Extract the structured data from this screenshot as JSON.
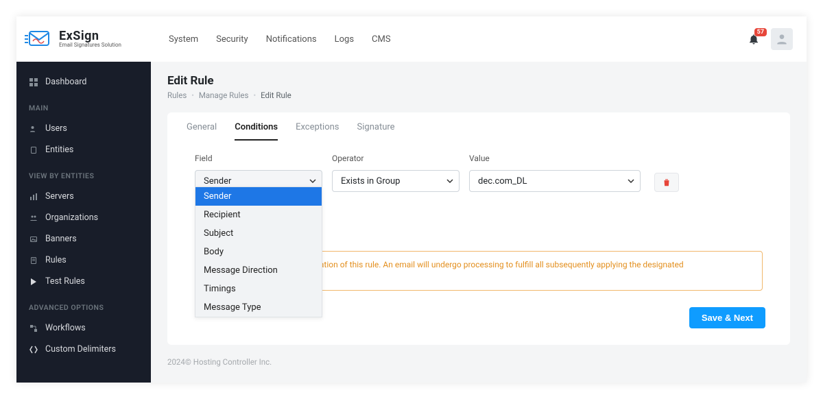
{
  "brand": {
    "name": "ExSign",
    "tagline": "Email Signatures Solution"
  },
  "topnav": {
    "items": [
      "System",
      "Security",
      "Notifications",
      "Logs",
      "CMS"
    ]
  },
  "notifications": {
    "count": "57"
  },
  "sidebar": {
    "dashboard": "Dashboard",
    "heading_main": "MAIN",
    "main_items": [
      "Users",
      "Entities"
    ],
    "heading_view": "VIEW BY ENTITIES",
    "view_items": [
      "Servers",
      "Organizations",
      "Banners",
      "Rules",
      "Test Rules"
    ],
    "heading_adv": "ADVANCED OPTIONS",
    "adv_items": [
      "Workflows",
      "Custom Delimiters"
    ]
  },
  "page": {
    "title": "Edit Rule",
    "crumbs": {
      "a": "Rules",
      "b": "Manage Rules",
      "c": "Edit Rule"
    }
  },
  "tabs": {
    "general": "General",
    "conditions": "Conditions",
    "exceptions": "Exceptions",
    "signature": "Signature"
  },
  "columns": {
    "field": "Field",
    "operator": "Operator",
    "value": "Value"
  },
  "row": {
    "field": "Sender",
    "operator": "Exists in Group",
    "value": "dec.com_DL"
  },
  "field_options": [
    "Sender",
    "Recipient",
    "Subject",
    "Body",
    "Message Direction",
    "Timings",
    "Message Type"
  ],
  "note": "must be satisfied for the application of this rule. An email will undergo processing to fulfill all subsequently applying the designated Signature/Disclaimer.",
  "save_next": "Save & Next",
  "footer": "2024© Hosting Controller Inc."
}
